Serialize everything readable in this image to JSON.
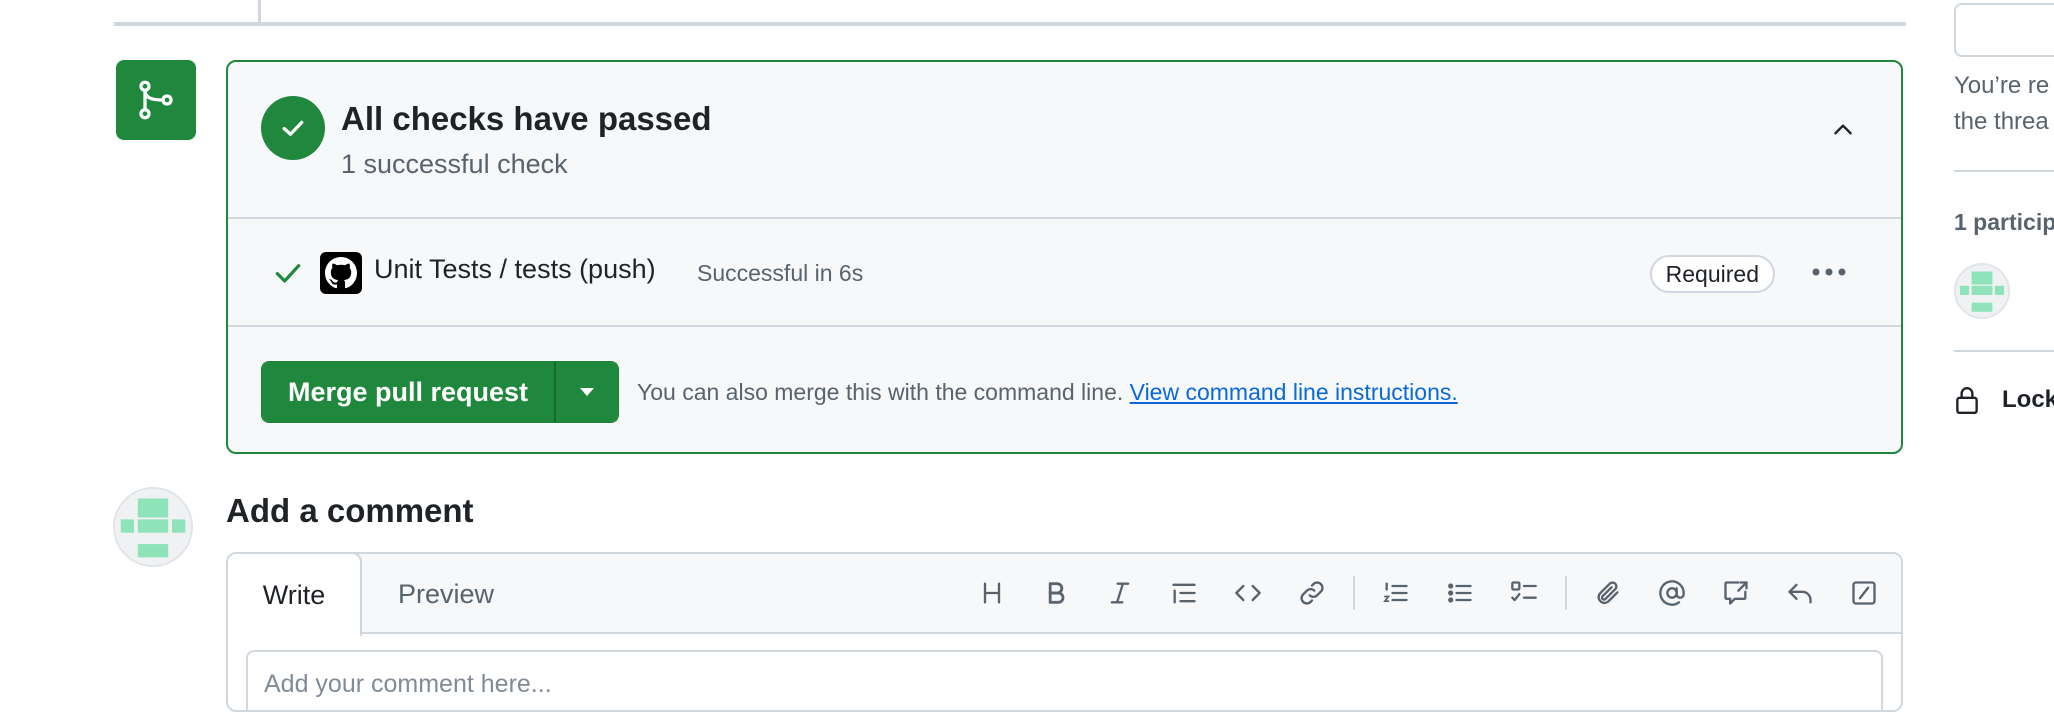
{
  "merge_box": {
    "status_title": "All checks have passed",
    "status_subtitle": "1 successful check",
    "checks": [
      {
        "name": "Unit Tests / tests (push)",
        "status": "Successful in 6s",
        "badge": "Required"
      }
    ],
    "merge_button_label": "Merge pull request",
    "merge_hint_text": "You can also merge this with the command line.",
    "merge_hint_link": "View command line instructions."
  },
  "comment": {
    "title": "Add a comment",
    "tabs": [
      "Write",
      "Preview"
    ],
    "placeholder": "Add your comment here...",
    "toolbar_icons": [
      "heading-icon",
      "bold-icon",
      "italic-icon",
      "quote-icon",
      "code-icon",
      "link-icon",
      "ordered-list-icon",
      "unordered-list-icon",
      "task-list-icon",
      "attach-icon",
      "mention-icon",
      "cross-reference-icon",
      "reply-icon",
      "slash-command-icon"
    ]
  },
  "sidebar": {
    "notice_line1": "You’re re",
    "notice_line2": "the threa",
    "participants_label": "1 particip",
    "lock_label": "Lock"
  },
  "colors": {
    "success": "#1f883d",
    "link": "#0969da",
    "muted_text": "#59636e",
    "border": "#d0d7de",
    "avatar_identicon": "#8fe3b9"
  }
}
